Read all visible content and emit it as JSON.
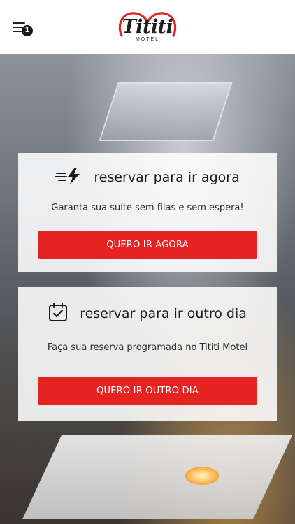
{
  "header": {
    "menu_badge": "1",
    "logo_text": "Tititi",
    "logo_subtext": "MOTEL"
  },
  "icons": {
    "menu": "hamburger-menu-icon",
    "now": "lightning-speed-icon",
    "later": "calendar-check-icon"
  },
  "colors": {
    "accent": "#e52321",
    "logo_heart": "#e52321",
    "text": "#1a1a1a"
  },
  "cards": {
    "now": {
      "title": "reservar para ir agora",
      "subtitle": "Garanta sua suíte sem filas e sem espera!",
      "button": "QUERO IR AGORA"
    },
    "later": {
      "title": "reservar para ir outro dia",
      "subtitle": "Faça sua reserva programada no Tititi Motel",
      "button": "QUERO IR OUTRO DIA"
    }
  }
}
